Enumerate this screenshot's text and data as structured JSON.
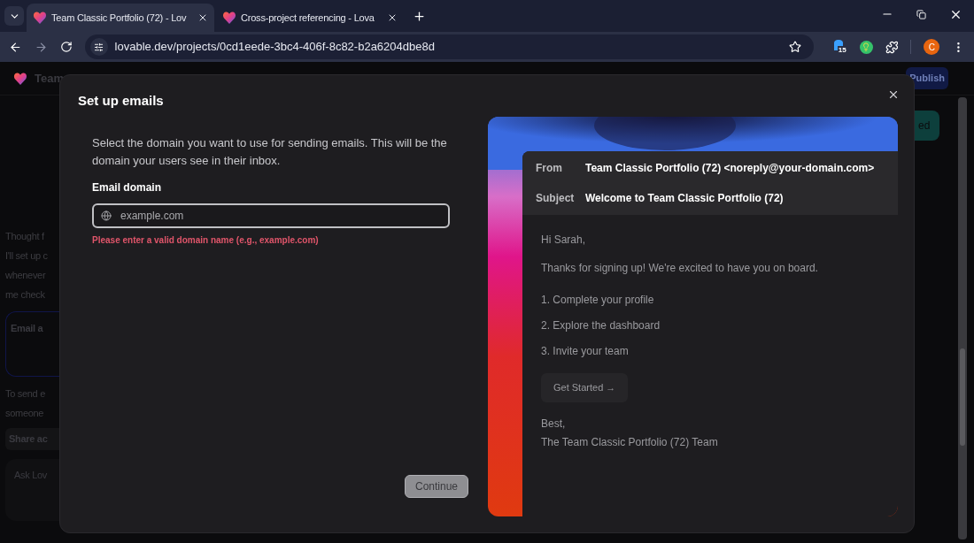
{
  "browser": {
    "tabs": [
      {
        "title": "Team Classic Portfolio (72) - Lov",
        "selected": true
      },
      {
        "title": "Cross-project referencing - Lova",
        "selected": false
      }
    ],
    "url": "lovable.dev/projects/0cd1eede-3bc4-406f-8c82-b2a6204dbe8d",
    "extension_badge": "15",
    "profile_initial": "C"
  },
  "background": {
    "project_name": "Team",
    "publish_button": "Publish",
    "partial_button": "ed",
    "chat": [
      {
        "kind": "text",
        "text": "Thought f"
      },
      {
        "kind": "text",
        "text": "I'll set up c"
      },
      {
        "kind": "text",
        "text": "whenever"
      },
      {
        "kind": "text",
        "text": "me check"
      },
      {
        "kind": "card",
        "text": "Email a"
      },
      {
        "kind": "text",
        "text": "To send e"
      },
      {
        "kind": "text",
        "text": "someone"
      },
      {
        "kind": "button",
        "text": "Share ac"
      }
    ],
    "chat_input_placeholder": "Ask Lov"
  },
  "dialog": {
    "title": "Set up emails",
    "description": "Select the domain you want to use for sending emails. This will be the domain your users see in their inbox.",
    "field_label": "Email domain",
    "placeholder": "example.com",
    "error": "Please enter a valid domain name (e.g., example.com)",
    "continue_button": {
      "label": "Continue",
      "disabled": true
    },
    "preview": {
      "from_label": "From",
      "from_value": "Team Classic Portfolio (72) <noreply@your-domain.com>",
      "subject_label": "Subject",
      "subject_value": "Welcome to Team Classic Portfolio (72)",
      "greeting": "Hi Sarah,",
      "intro": "Thanks for signing up! We're excited to have you on board.",
      "steps": [
        "1. Complete your profile",
        "2. Explore the dashboard",
        "3. Invite your team"
      ],
      "cta": "Get Started →",
      "signoff": "Best,",
      "signature": "The Team Classic Portfolio (72) Team"
    }
  }
}
